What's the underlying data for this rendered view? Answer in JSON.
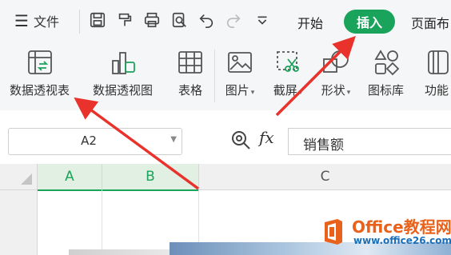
{
  "menu": {
    "file_label": "文件",
    "tabs": [
      {
        "label": "开始"
      },
      {
        "label": "插入",
        "active": true
      },
      {
        "label": "页面布"
      }
    ]
  },
  "quick_access_icons": [
    "save-icon",
    "format-painter-icon",
    "print-icon",
    "print-preview-icon",
    "undo-icon",
    "redo-icon",
    "more-dropdown-icon"
  ],
  "ribbon": {
    "buttons": [
      {
        "label": "数据透视表",
        "icon": "pivot-table-icon"
      },
      {
        "label": "数据透视图",
        "icon": "pivot-chart-icon"
      },
      {
        "label": "表格",
        "icon": "table-icon"
      },
      {
        "label": "图片",
        "icon": "picture-icon",
        "dropdown": true
      },
      {
        "label": "截屏",
        "icon": "screenshot-icon",
        "dropdown": true
      },
      {
        "label": "形状",
        "icon": "shapes-icon",
        "dropdown": true
      },
      {
        "label": "图标库",
        "icon": "icon-library-icon"
      },
      {
        "label": "功能",
        "icon": "function-icon"
      }
    ]
  },
  "formula_bar": {
    "name_box": "A2",
    "fx_label": "fx",
    "content": "销售额"
  },
  "sheet": {
    "columns": [
      "A",
      "B",
      "C"
    ],
    "selected_columns": [
      "A",
      "B"
    ]
  },
  "watermark": {
    "title": "Office教程网",
    "url": "www.office26.com"
  },
  "colors": {
    "accent": "#1aa35a",
    "annotation_arrow": "#e8322b"
  }
}
